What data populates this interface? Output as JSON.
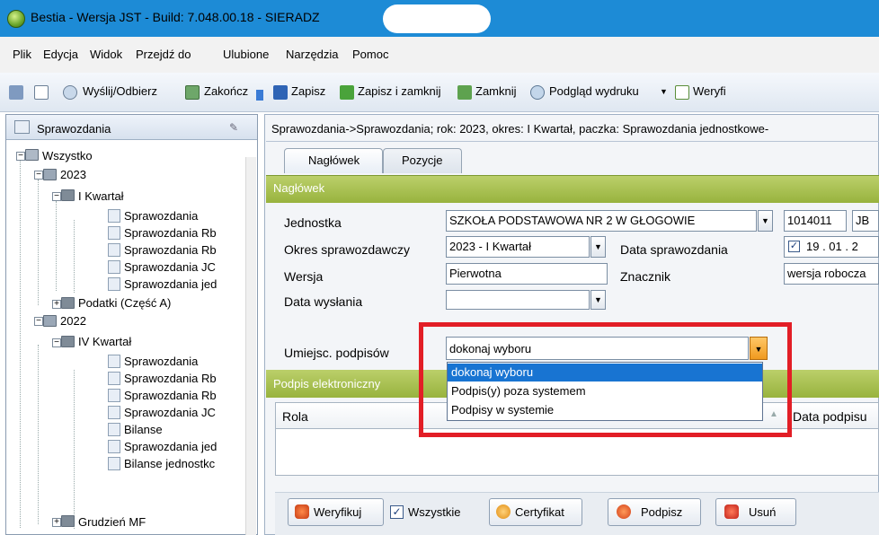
{
  "window": {
    "title": "Bestia - Wersja JST - Build: 7.048.00.18 - SIERADZ"
  },
  "menu": [
    "Plik",
    "Edycja",
    "Widok",
    "Przejdź do",
    "Ulubione",
    "Narzędzia",
    "Pomoc"
  ],
  "toolbar": {
    "send_receive": "Wyślij/Odbierz",
    "close_app": "Zakończ",
    "save": "Zapisz",
    "save_close": "Zapisz i zamknij",
    "close": "Zamknij",
    "preview": "Podgląd wydruku",
    "verify": "Weryfi"
  },
  "left_panel": {
    "title": "Sprawozdania",
    "tree": [
      "Wszystko",
      "2023",
      "I Kwartał",
      "Sprawozdania",
      "Sprawozdania Rb",
      "Sprawozdania Rb",
      "Sprawozdania JC",
      "Sprawozdania jed",
      "Podatki (Część A)",
      "2022",
      "IV Kwartał",
      "Sprawozdania",
      "Sprawozdania Rb",
      "Sprawozdania Rb",
      "Sprawozdania JC",
      "Bilanse",
      "Sprawozdania jed",
      "Bilanse jednostkc",
      "Grudzień MF"
    ]
  },
  "breadcrumb": "Sprawozdania->Sprawozdania; rok: 2023, okres: I Kwartał, paczka: Sprawozdania jednostkowe-",
  "tabs": [
    "Nagłówek",
    "Pozycje"
  ],
  "header_section": {
    "title": "Nagłówek",
    "jednostka_label": "Jednostka",
    "jednostka_value": "SZKOŁA PODSTAWOWA NR 2 W GŁOGOWIE",
    "jednostka_code": "1014011",
    "jednostka_type": "JB",
    "okres_label": "Okres sprawozdawczy",
    "okres_value": "2023 - I Kwartał",
    "data_spr_label": "Data sprawozdania",
    "data_spr_value": "19 . 01 . 2",
    "wersja_label": "Wersja",
    "wersja_value": "Pierwotna",
    "znacznik_label": "Znacznik",
    "znacznik_value": "wersja robocza",
    "data_wys_label": "Data wysłania",
    "umiejsc_label": "Umiejsc. podpisów",
    "umiejsc_value": "dokonaj wyboru"
  },
  "dropdown": {
    "options": [
      "dokonaj wyboru",
      "Podpis(y) poza systemem",
      "Podpisy w systemie"
    ],
    "selected": 0
  },
  "signature_section": {
    "title": "Podpis elektroniczny",
    "col_role": "Rola",
    "col_date": "Data podpisu"
  },
  "bottom": {
    "verify": "Weryfikuj",
    "all": "Wszystkie",
    "certificate": "Certyfikat",
    "sign": "Podpisz",
    "delete": "Usuń"
  },
  "colors": {
    "title_bar": "#1d8bd6",
    "section_green": "#a8c04e",
    "highlight_red": "#e21e26",
    "selection_blue": "#1874d2"
  }
}
